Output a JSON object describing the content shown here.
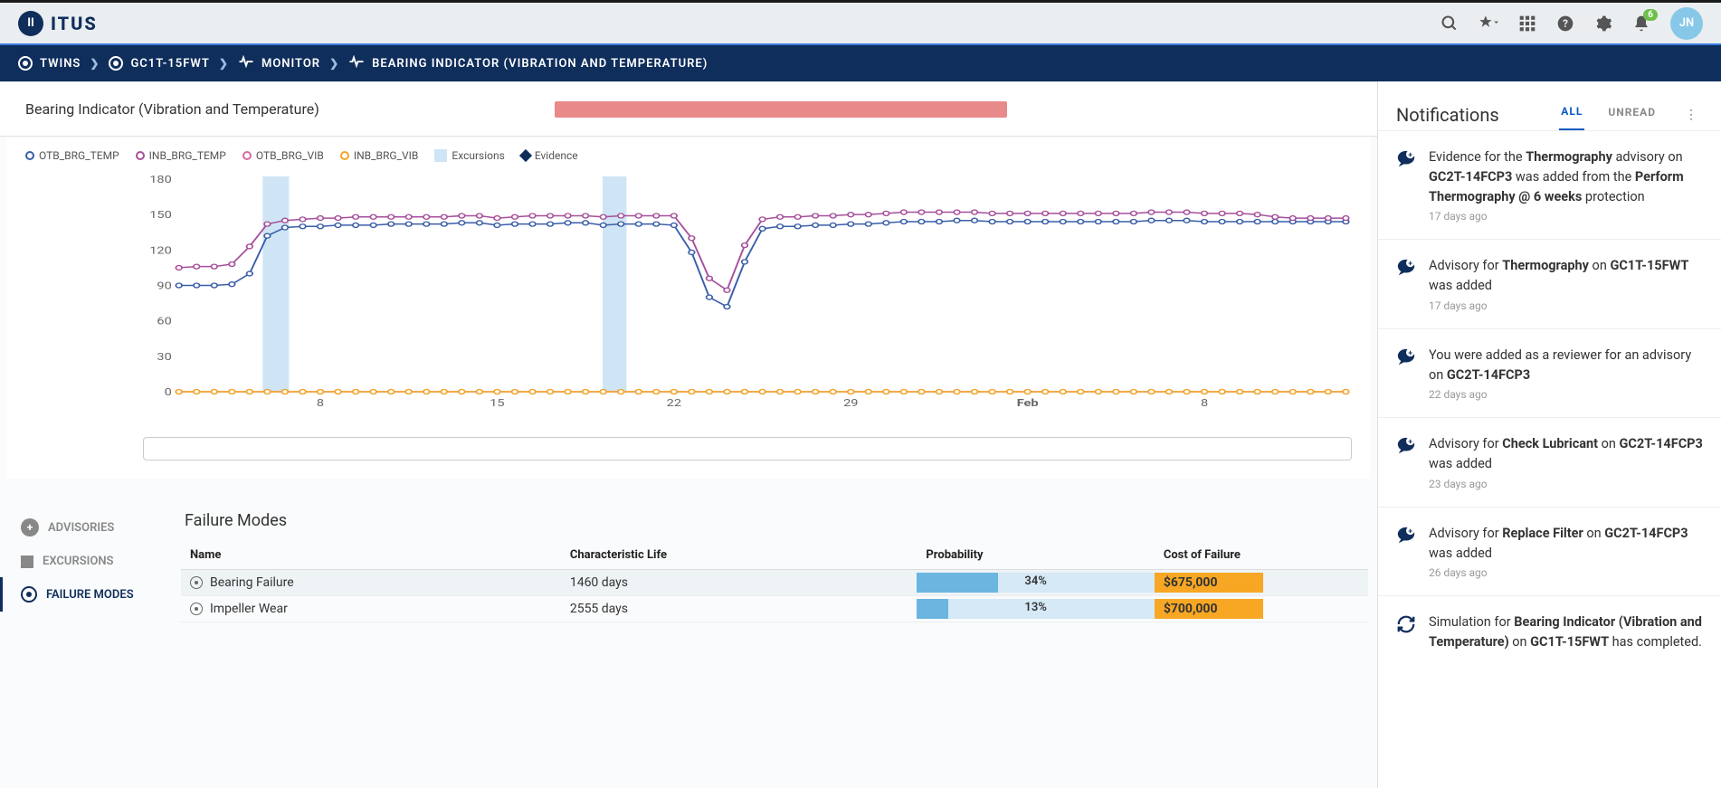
{
  "app": {
    "name": "ITUS"
  },
  "toolbar": {
    "notification_count": "6",
    "avatar_initials": "JN"
  },
  "breadcrumb": [
    {
      "label": "TWINS"
    },
    {
      "label": "GC1T-15FWT"
    },
    {
      "label": "MONITOR"
    },
    {
      "label": "BEARING INDICATOR (VIBRATION AND TEMPERATURE)"
    }
  ],
  "page": {
    "title": "Bearing Indicator (Vibration and Temperature)"
  },
  "legend": {
    "s1": "OTB_BRG_TEMP",
    "s2": "INB_BRG_TEMP",
    "s3": "OTB_BRG_VIB",
    "s4": "INB_BRG_VIB",
    "exc": "Excursions",
    "ev": "Evidence"
  },
  "chart_data": {
    "type": "line",
    "ylim": [
      0,
      180
    ],
    "yticks": [
      0,
      30,
      60,
      90,
      120,
      150,
      180
    ],
    "x_categories": [
      "8",
      "15",
      "22",
      "29",
      "Feb",
      "8"
    ],
    "excursion_zones": [
      {
        "x": 70,
        "w": 22
      },
      {
        "x": 354,
        "w": 20
      }
    ],
    "series": [
      {
        "name": "OTB_BRG_TEMP",
        "color": "#3a5ea8",
        "values": [
          90,
          90,
          90,
          91,
          100,
          132,
          139,
          140,
          140,
          141,
          141,
          141,
          142,
          142,
          142,
          142,
          143,
          143,
          141,
          142,
          142,
          142,
          143,
          143,
          141,
          142,
          142,
          142,
          141,
          118,
          80,
          72,
          110,
          138,
          140,
          140,
          141,
          141,
          142,
          142,
          143,
          144,
          144,
          144,
          145,
          145,
          144,
          144,
          144,
          144,
          144,
          144,
          144,
          144,
          144,
          145,
          145,
          145,
          144,
          144,
          144,
          144,
          144,
          144,
          144,
          144,
          144
        ]
      },
      {
        "name": "INB_BRG_TEMP",
        "color": "#a64f9b",
        "values": [
          105,
          106,
          106,
          108,
          123,
          142,
          145,
          146,
          147,
          147,
          148,
          148,
          148,
          148,
          148,
          148,
          149,
          149,
          147,
          148,
          149,
          149,
          149,
          149,
          148,
          149,
          149,
          149,
          149,
          130,
          96,
          86,
          124,
          146,
          148,
          148,
          149,
          149,
          150,
          150,
          151,
          152,
          152,
          152,
          152,
          152,
          151,
          151,
          151,
          151,
          151,
          151,
          151,
          151,
          151,
          152,
          152,
          152,
          151,
          151,
          151,
          150,
          148,
          147,
          147,
          147,
          147
        ]
      },
      {
        "name": "OTB_BRG_VIB",
        "color": "#d96aa0",
        "values": [
          0,
          0,
          0,
          0,
          0,
          0,
          0,
          0,
          0,
          0,
          0,
          0,
          0,
          0,
          0,
          0,
          0,
          0,
          0,
          0,
          0,
          0,
          0,
          0,
          0,
          0,
          0,
          0,
          0,
          0,
          0,
          0,
          0,
          0,
          0,
          0,
          0,
          0,
          0,
          0,
          0,
          0,
          0,
          0,
          0,
          0,
          0,
          0,
          0,
          0,
          0,
          0,
          0,
          0,
          0,
          0,
          0,
          0,
          0,
          0,
          0,
          0,
          0,
          0,
          0,
          0,
          0
        ]
      },
      {
        "name": "INB_BRG_VIB",
        "color": "#f5a623",
        "values": [
          0,
          0,
          0,
          0,
          0,
          0,
          0,
          0,
          0,
          0,
          0,
          0,
          0,
          0,
          0,
          0,
          0,
          0,
          0,
          0,
          0,
          0,
          0,
          0,
          0,
          0,
          0,
          0,
          0,
          0,
          0,
          0,
          0,
          0,
          0,
          0,
          0,
          0,
          0,
          0,
          0,
          0,
          0,
          0,
          0,
          0,
          0,
          0,
          0,
          0,
          0,
          0,
          0,
          0,
          0,
          0,
          0,
          0,
          0,
          0,
          0,
          0,
          0,
          0,
          0,
          0,
          0
        ]
      }
    ]
  },
  "side_tabs": {
    "advisories": "ADVISORIES",
    "excursions": "EXCURSIONS",
    "failure_modes": "FAILURE MODES"
  },
  "failure_modes": {
    "title": "Failure Modes",
    "headers": {
      "name": "Name",
      "life": "Characteristic Life",
      "prob": "Probability",
      "cost": "Cost of Failure"
    },
    "rows": [
      {
        "name": "Bearing Failure",
        "life": "1460 days",
        "prob": "34%",
        "prob_pct": 34,
        "cost": "$675,000"
      },
      {
        "name": "Impeller Wear",
        "life": "2555 days",
        "prob": "13%",
        "prob_pct": 13,
        "cost": "$700,000"
      }
    ]
  },
  "notifications": {
    "title": "Notifications",
    "tab_all": "ALL",
    "tab_unread": "UNREAD",
    "items": [
      {
        "html": "Evidence for the <b>Thermography</b> advisory on <b>GC2T-14FCP3</b> was added from the <b>Perform Thermography @ 6 weeks</b> protection",
        "time": "17 days ago",
        "icon": "plus"
      },
      {
        "html": "Advisory for <b>Thermography</b> on <b>GC1T-15FWT</b> was added",
        "time": "17 days ago",
        "icon": "plus"
      },
      {
        "html": "You were added as a reviewer for an advisory on <b>GC2T-14FCP3</b>",
        "time": "22 days ago",
        "icon": "plus"
      },
      {
        "html": "Advisory for <b>Check Lubricant</b> on <b>GC2T-14FCP3</b> was added",
        "time": "23 days ago",
        "icon": "plus"
      },
      {
        "html": "Advisory for <b>Replace Filter</b> on <b>GC2T-14FCP3</b> was added",
        "time": "26 days ago",
        "icon": "plus"
      },
      {
        "html": "Simulation for <b>Bearing Indicator (Vibration and Temperature)</b> on <b>GC1T-15FWT</b> has completed.",
        "time": "",
        "icon": "refresh"
      }
    ]
  }
}
